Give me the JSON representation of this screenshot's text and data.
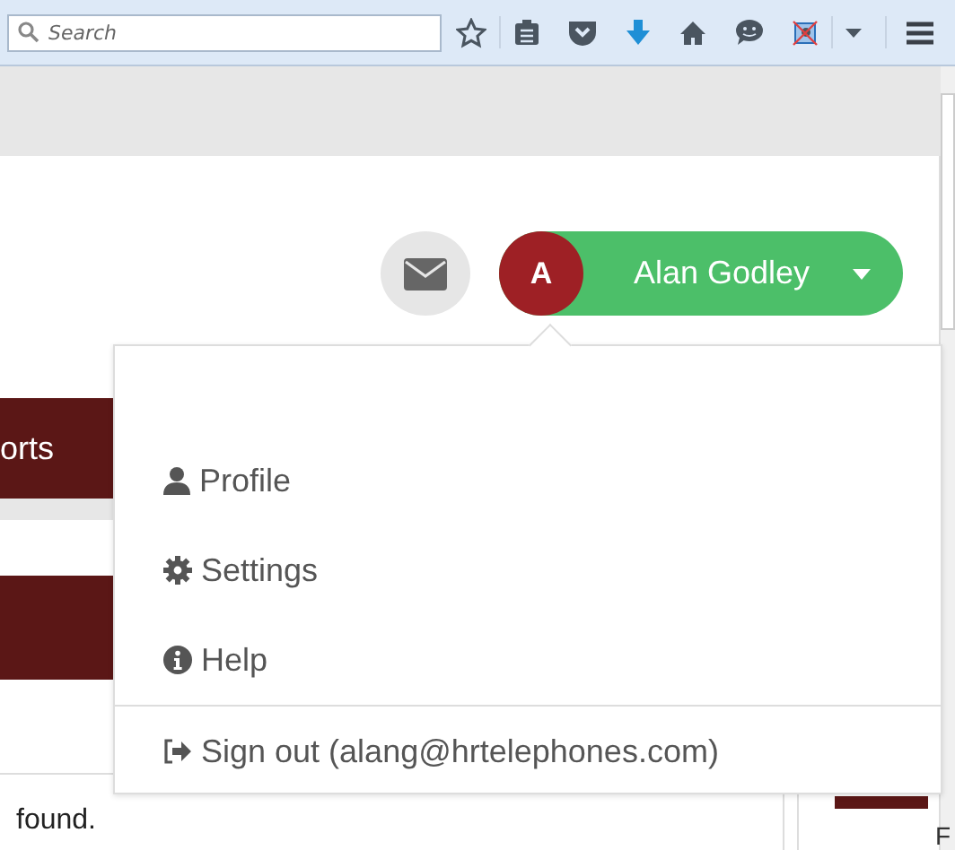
{
  "browser_toolbar": {
    "search": {
      "placeholder": "Search"
    }
  },
  "header": {
    "user": {
      "initial": "A",
      "name": "Alan Godley"
    }
  },
  "left_nav": {
    "tab_label": "orts"
  },
  "content": {
    "text": "found.",
    "side_text": "F"
  },
  "user_menu": {
    "items": [
      {
        "kind": "profile",
        "label": "Profile"
      },
      {
        "kind": "settings",
        "label": "Settings"
      },
      {
        "kind": "help",
        "label": "Help"
      },
      {
        "kind": "signout",
        "label": "Sign out (alang@hrtelephones.com)"
      }
    ]
  }
}
